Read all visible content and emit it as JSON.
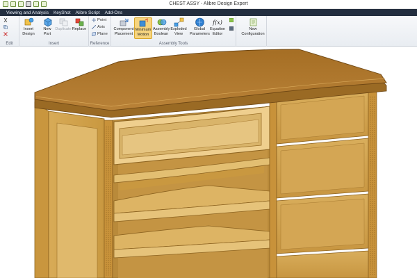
{
  "window": {
    "title": "CHEST ASSY - Alibre Design Expert"
  },
  "menu": {
    "items": [
      "Viewing and Analysis",
      "KeyShot",
      "Alibre Script",
      "Add-Ons"
    ]
  },
  "ribbon": {
    "groups": {
      "edit": "Edit",
      "insert": "Insert",
      "reference": "Reference",
      "assembly_tools": "Assembly Tools"
    },
    "buttons": {
      "insert_design": "Insert Design",
      "new_part": "New Part",
      "duplicate": "Duplicate",
      "replace": "Replace",
      "point": "Point",
      "axis": "Axis",
      "plane": "Plane",
      "component_placement": "Component Placement",
      "minimum_motion": "Minimum Motion",
      "assembly_boolean": "Assembly Boolean",
      "exploded_view": "Exploded View",
      "global_parameters": "Global Parameters",
      "equation_editor": "Equation Editor",
      "new_configuration": "New Configuration"
    },
    "icon_glyphs": {
      "equation_editor": "f(x)"
    },
    "active_button": "minimum_motion"
  },
  "colors": {
    "menubar_bg": "#232e3f",
    "wood_top": "#b27a2c",
    "wood_body": "#d2a452",
    "wood_light": "#e3bf72",
    "active_highlight": "#f7d57f"
  }
}
